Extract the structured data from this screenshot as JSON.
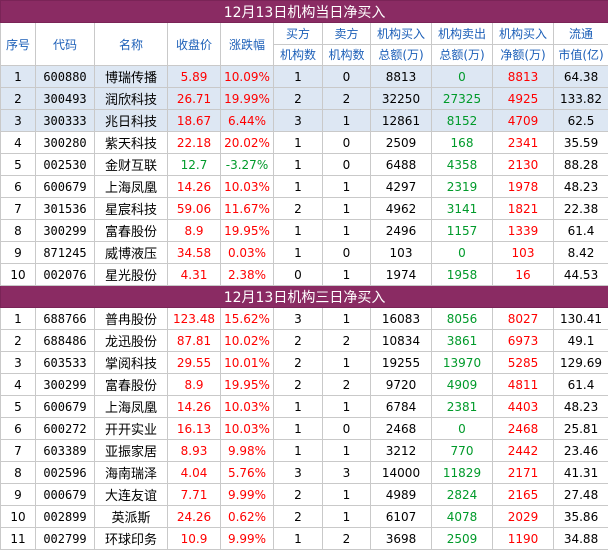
{
  "section1": {
    "title": "12月13日机构当日净买入",
    "headers": {
      "seq": "序号",
      "code": "代码",
      "name": "名称",
      "close": "收盘价",
      "change": "涨跌幅",
      "buyers_top": "买方",
      "buyers_bottom": "机构数",
      "sellers_top": "卖方",
      "sellers_bottom": "机构数",
      "buy_top": "机构买入",
      "buy_bottom": "总额(万)",
      "sell_top": "机构卖出",
      "sell_bottom": "总额(万)",
      "net_top": "机构买入",
      "net_bottom": "净额(万)",
      "cap_top": "流通",
      "cap_bottom": "市值(亿)"
    },
    "rows": [
      {
        "seq": "1",
        "code": "600880",
        "name": "博瑞传播",
        "close": "5.89",
        "change": "10.09%",
        "buyers": "1",
        "sellers": "0",
        "buy": "8813",
        "sell": "0",
        "net": "8813",
        "cap": "64.38",
        "hl": true,
        "close_color": "red",
        "change_color": "red"
      },
      {
        "seq": "2",
        "code": "300493",
        "name": "润欣科技",
        "close": "26.71",
        "change": "19.99%",
        "buyers": "2",
        "sellers": "2",
        "buy": "32250",
        "sell": "27325",
        "net": "4925",
        "cap": "133.82",
        "hl": true,
        "close_color": "red",
        "change_color": "red"
      },
      {
        "seq": "3",
        "code": "300333",
        "name": "兆日科技",
        "close": "18.67",
        "change": "6.44%",
        "buyers": "3",
        "sellers": "1",
        "buy": "12861",
        "sell": "8152",
        "net": "4709",
        "cap": "62.5",
        "hl": true,
        "close_color": "red",
        "change_color": "red"
      },
      {
        "seq": "4",
        "code": "300280",
        "name": "紫天科技",
        "close": "22.18",
        "change": "20.02%",
        "buyers": "1",
        "sellers": "0",
        "buy": "2509",
        "sell": "168",
        "net": "2341",
        "cap": "35.59",
        "hl": false,
        "close_color": "red",
        "change_color": "red"
      },
      {
        "seq": "5",
        "code": "002530",
        "name": "金财互联",
        "close": "12.7",
        "change": "-3.27%",
        "buyers": "1",
        "sellers": "0",
        "buy": "6488",
        "sell": "4358",
        "net": "2130",
        "cap": "88.28",
        "hl": false,
        "close_color": "green",
        "change_color": "green"
      },
      {
        "seq": "6",
        "code": "600679",
        "name": "上海凤凰",
        "close": "14.26",
        "change": "10.03%",
        "buyers": "1",
        "sellers": "1",
        "buy": "4297",
        "sell": "2319",
        "net": "1978",
        "cap": "48.23",
        "hl": false,
        "close_color": "red",
        "change_color": "red"
      },
      {
        "seq": "7",
        "code": "301536",
        "name": "星宸科技",
        "close": "59.06",
        "change": "11.67%",
        "buyers": "2",
        "sellers": "1",
        "buy": "4962",
        "sell": "3141",
        "net": "1821",
        "cap": "22.38",
        "hl": false,
        "close_color": "red",
        "change_color": "red"
      },
      {
        "seq": "8",
        "code": "300299",
        "name": "富春股份",
        "close": "8.9",
        "change": "19.95%",
        "buyers": "1",
        "sellers": "1",
        "buy": "2496",
        "sell": "1157",
        "net": "1339",
        "cap": "61.4",
        "hl": false,
        "close_color": "red",
        "change_color": "red"
      },
      {
        "seq": "9",
        "code": "871245",
        "name": "威博液压",
        "close": "34.58",
        "change": "0.03%",
        "buyers": "1",
        "sellers": "0",
        "buy": "103",
        "sell": "0",
        "net": "103",
        "cap": "8.42",
        "hl": false,
        "close_color": "red",
        "change_color": "red"
      },
      {
        "seq": "10",
        "code": "002076",
        "name": "星光股份",
        "close": "4.31",
        "change": "2.38%",
        "buyers": "0",
        "sellers": "1",
        "buy": "1974",
        "sell": "1958",
        "net": "16",
        "cap": "44.53",
        "hl": false,
        "close_color": "red",
        "change_color": "red"
      }
    ]
  },
  "section2": {
    "title": "12月13日机构三日净买入",
    "rows": [
      {
        "seq": "1",
        "code": "688766",
        "name": "普冉股份",
        "close": "123.48",
        "change": "15.62%",
        "buyers": "3",
        "sellers": "1",
        "buy": "16083",
        "sell": "8056",
        "net": "8027",
        "cap": "130.41",
        "close_color": "red",
        "change_color": "red"
      },
      {
        "seq": "2",
        "code": "688486",
        "name": "龙迅股份",
        "close": "87.81",
        "change": "10.02%",
        "buyers": "2",
        "sellers": "2",
        "buy": "10834",
        "sell": "3861",
        "net": "6973",
        "cap": "49.1",
        "close_color": "red",
        "change_color": "red"
      },
      {
        "seq": "3",
        "code": "603533",
        "name": "掌阅科技",
        "close": "29.55",
        "change": "10.01%",
        "buyers": "2",
        "sellers": "1",
        "buy": "19255",
        "sell": "13970",
        "net": "5285",
        "cap": "129.69",
        "close_color": "red",
        "change_color": "red"
      },
      {
        "seq": "4",
        "code": "300299",
        "name": "富春股份",
        "close": "8.9",
        "change": "19.95%",
        "buyers": "2",
        "sellers": "2",
        "buy": "9720",
        "sell": "4909",
        "net": "4811",
        "cap": "61.4",
        "close_color": "red",
        "change_color": "red"
      },
      {
        "seq": "5",
        "code": "600679",
        "name": "上海凤凰",
        "close": "14.26",
        "change": "10.03%",
        "buyers": "1",
        "sellers": "1",
        "buy": "6784",
        "sell": "2381",
        "net": "4403",
        "cap": "48.23",
        "close_color": "red",
        "change_color": "red"
      },
      {
        "seq": "6",
        "code": "600272",
        "name": "开开实业",
        "close": "16.13",
        "change": "10.03%",
        "buyers": "1",
        "sellers": "0",
        "buy": "2468",
        "sell": "0",
        "net": "2468",
        "cap": "25.81",
        "close_color": "red",
        "change_color": "red"
      },
      {
        "seq": "7",
        "code": "603389",
        "name": "亚振家居",
        "close": "8.93",
        "change": "9.98%",
        "buyers": "1",
        "sellers": "1",
        "buy": "3212",
        "sell": "770",
        "net": "2442",
        "cap": "23.46",
        "close_color": "red",
        "change_color": "red"
      },
      {
        "seq": "8",
        "code": "002596",
        "name": "海南瑞泽",
        "close": "4.04",
        "change": "5.76%",
        "buyers": "3",
        "sellers": "3",
        "buy": "14000",
        "sell": "11829",
        "net": "2171",
        "cap": "41.31",
        "close_color": "red",
        "change_color": "red"
      },
      {
        "seq": "9",
        "code": "000679",
        "name": "大连友谊",
        "close": "7.71",
        "change": "9.99%",
        "buyers": "2",
        "sellers": "1",
        "buy": "4989",
        "sell": "2824",
        "net": "2165",
        "cap": "27.48",
        "close_color": "red",
        "change_color": "red"
      },
      {
        "seq": "10",
        "code": "002899",
        "name": "英派斯",
        "close": "24.26",
        "change": "0.62%",
        "buyers": "2",
        "sellers": "1",
        "buy": "6107",
        "sell": "4078",
        "net": "2029",
        "cap": "35.86",
        "close_color": "red",
        "change_color": "red"
      },
      {
        "seq": "11",
        "code": "002799",
        "name": "环球印务",
        "close": "10.9",
        "change": "9.99%",
        "buyers": "1",
        "sellers": "2",
        "buy": "3698",
        "sell": "2509",
        "net": "1190",
        "cap": "34.88",
        "close_color": "red",
        "change_color": "red"
      }
    ]
  },
  "colors": {
    "banner": "#8a2b63",
    "header_text": "#1c5fb8",
    "highlight_row": "#dde7f3",
    "up": "#ff0000",
    "down": "#009a2a",
    "sell_col": "#009a2a",
    "net_col": "#ff0000"
  }
}
